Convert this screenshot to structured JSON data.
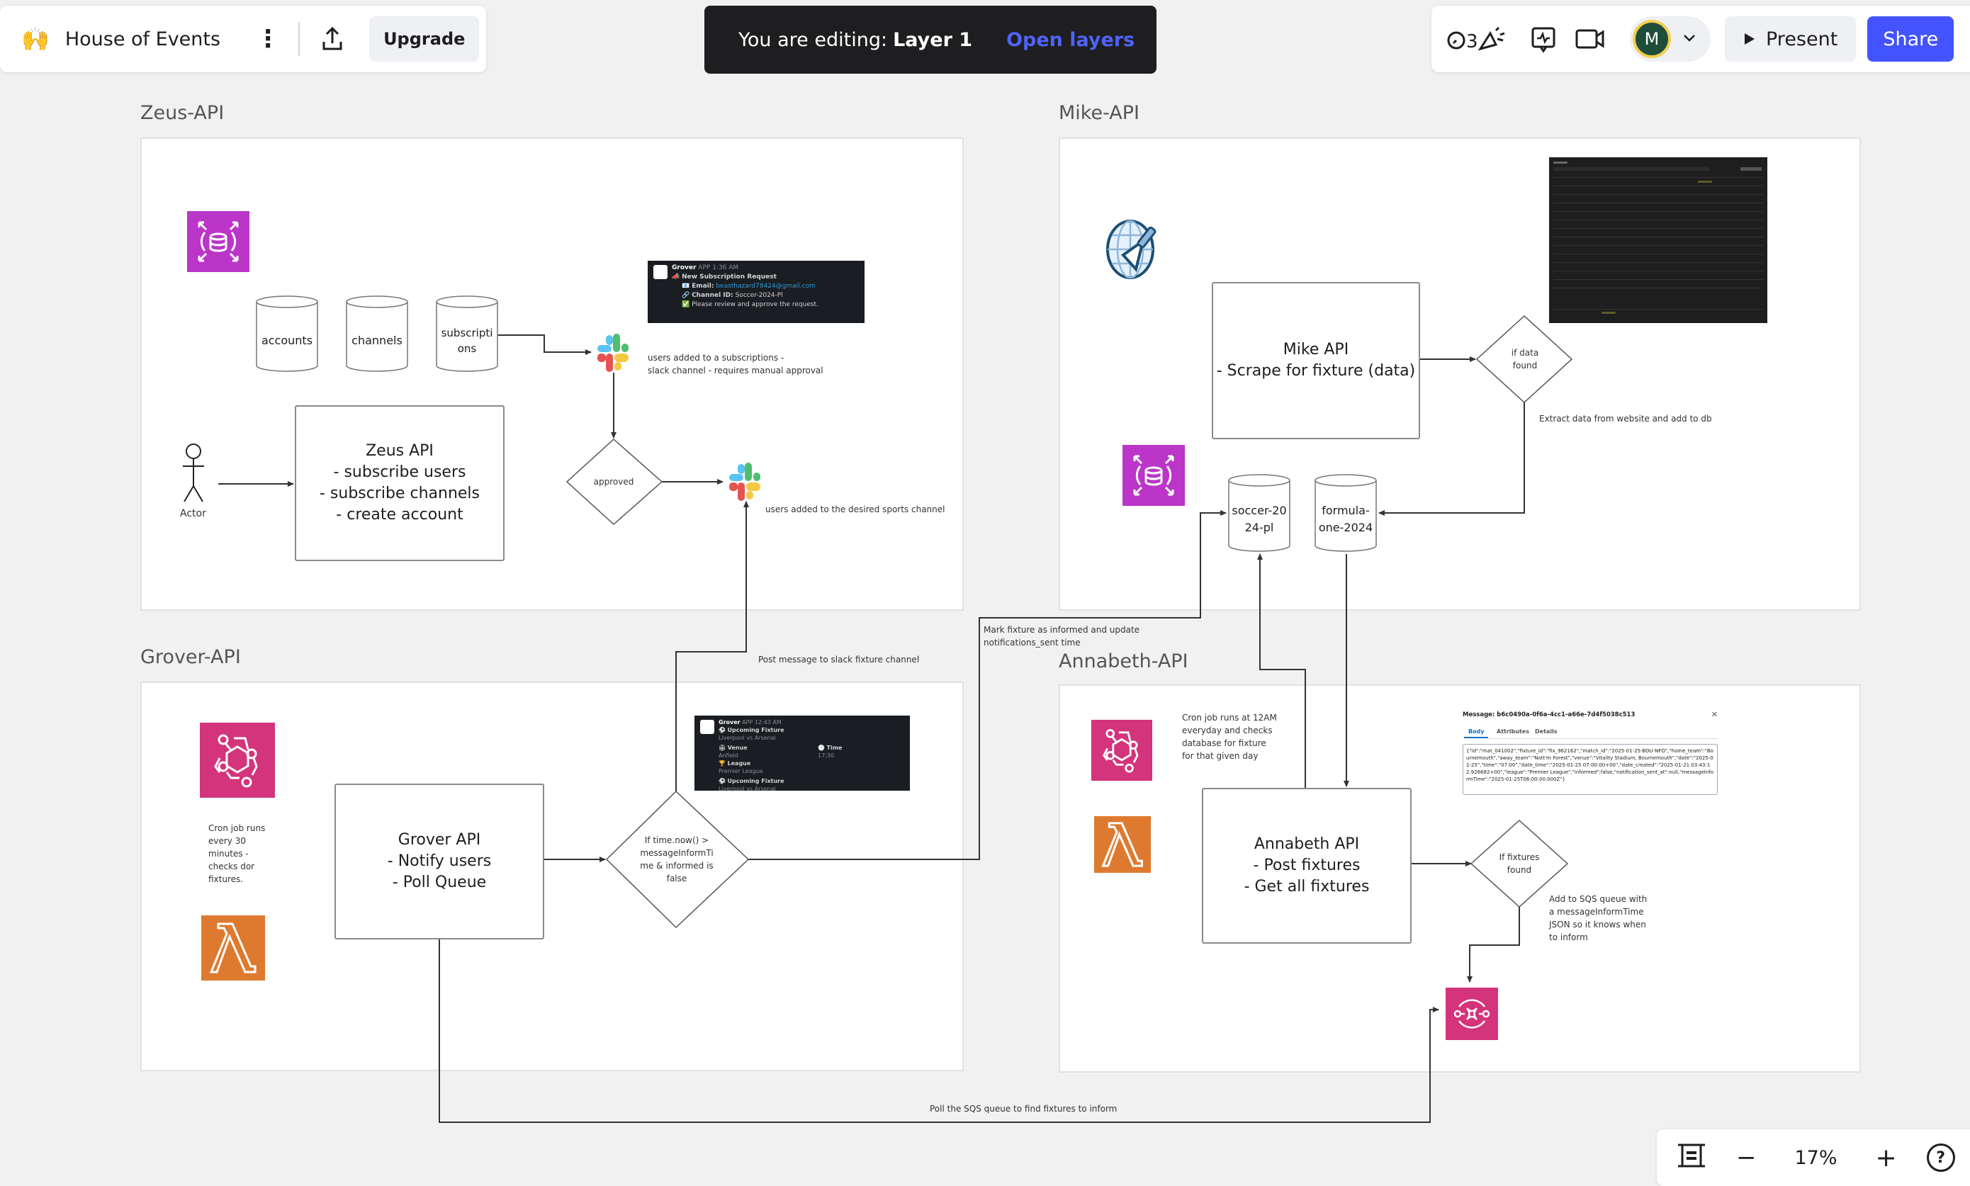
{
  "toolbar": {
    "board_emoji": "🙌",
    "board_title": "House of Events",
    "more_icon": "more-vertical-icon",
    "export_icon": "upload-icon",
    "upgrade_label": "Upgrade"
  },
  "editing_banner": {
    "prefix": "You are editing:",
    "layer": "Layer 1",
    "link": "Open layers"
  },
  "right_toolbar": {
    "icons": [
      "reactions-icon",
      "comment-icon",
      "video-icon"
    ],
    "avatar_initial": "M",
    "present_label": "Present",
    "share_label": "Share",
    "colors": {
      "share": "#4353ff",
      "avatar_bg": "#1e4d3a",
      "avatar_ring": "#f4cf4f"
    }
  },
  "zoom_controls": {
    "fit_icon": "fit-screen-icon",
    "zoom_out": "−",
    "zoom_level": "17%",
    "zoom_in": "+",
    "help": "?"
  },
  "frames": {
    "zeus": {
      "title": "Zeus-API",
      "databases": [
        "accounts",
        "channels",
        "subscripti\nons"
      ],
      "main_node": "Zeus API\n- subscribe users\n- subscribe channels\n- create account",
      "actor_label": "Actor",
      "decision": "approved",
      "note_subscriptions": "users added to a subscriptions -\nslack channel - requires manual approval",
      "note_sports": "users added to the desired sports channel",
      "slack_card": {
        "sender": "Grover",
        "badge": "APP",
        "time": "1:36 AM",
        "title": "New Subscription Request",
        "email_label": "Email:",
        "email": "beasthazard78424@gmail.com",
        "channel_label": "Channel ID:",
        "channel": "Soccer-2024-Pl",
        "footer": "Please review and approve the request."
      }
    },
    "mike": {
      "title": "Mike-API",
      "main_node": "Mike API\n- Scrape for fixture (data)",
      "decision": "if data\nfound",
      "note_extract": "Extract data from website and add to db",
      "databases": [
        "soccer-20\n24-pl",
        "formula-\none-2024"
      ]
    },
    "grover": {
      "title": "Grover-API",
      "main_node": "Grover API\n- Notify users\n- Poll Queue",
      "note_cron": "Cron job runs\nevery 30\nminutes -\nchecks dor\nfixtures.",
      "decision": "If time.now() >\nmessageInformTi\nme & informed is\nfalse",
      "slack_card": {
        "sender": "Grover",
        "badge": "APP",
        "time": "12:43 AM",
        "heading": "Upcoming Fixture",
        "match": "Liverpool vs Arsenal",
        "venue_label": "Venue",
        "venue": "Anfield",
        "time_label": "Time",
        "kickoff": "17:30",
        "league_label": "League",
        "league": "Premier League",
        "heading2": "Upcoming Fixture",
        "match2": "Liverpool vs Arsenal"
      }
    },
    "annabeth": {
      "title": "Annabeth-API",
      "main_node": "Annabeth API\n- Post fixtures\n- Get all fixtures",
      "note_cron": "Cron job runs at 12AM\neveryday and checks\ndatabase for fixture\nfor that given day",
      "decision": "If fixtures\nfound",
      "note_sqs": "Add to SQS queue with\na messageInformTime\nJSON so it knows when\nto inform",
      "sqs_message": {
        "title": "Message: b6c0490a-0f6a-4cc1-a66e-7d4f5038c513",
        "tabs": [
          "Body",
          "Attributes",
          "Details"
        ],
        "body": "{\"id\":\"mat_041002\",\"fixture_id\":\"fix_962162\",\"match_id\":\"2025-01-25-BOU-NFO\",\"home_team\":\"Bournemouth\",\"away_team\":\"Nott'm Forest\",\"venue\":\"Vitality Stadium, Bournemouth\",\"date\":\"2025-01-25\",\"time\":\"07:00\",\"date_time\":\"2025-01-25 07:00:00+00\",\"date_created\":\"2025-01-21 03:43:12.926682+00\",\"league\":\"Premier League\",\"informed\":false,\"notification_sent_at\":null,\"messageInformTime\":\"2025-01-25T06:00:00.000Z\"}"
      }
    }
  },
  "connectors": {
    "post_slack": "Post message to slack fixture channel",
    "mark_informed": "Mark fixture as informed and update\nnotifications_sent time",
    "poll_sqs": "Poll the SQS queue to find fixtures to inform"
  },
  "colors": {
    "canvas": "#f1f1f1",
    "aws_database": "#bb35c9",
    "aws_eventbridge": "#d3347b",
    "aws_lambda": "#de7a2f",
    "aws_sqs": "#d3347b",
    "link_blue": "#4f63f5"
  }
}
